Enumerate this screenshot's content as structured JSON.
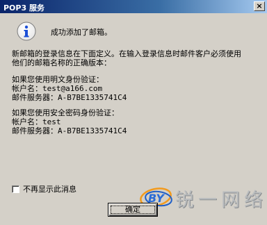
{
  "window": {
    "title": "POP3 服务",
    "close_label": "×"
  },
  "message": {
    "heading": "成功添加了邮箱。",
    "intro": [
      "新邮箱的登录信息在下面定义。在输入登录信息时邮件客户必须使用",
      "他们的邮箱名称的正确版本："
    ],
    "plaintext": {
      "heading": "如果您使用明文身份验证：",
      "account_label": "帐户名：",
      "account_value": "test@a166.com",
      "server_label": "邮件服务器：",
      "server_value": "A-B7BE1335741C4"
    },
    "spa": {
      "heading": "如果您使用安全密码身份验证：",
      "account_label": "帐户名：",
      "account_value": "test",
      "server_label": "邮件服务器：",
      "server_value": "A-B7BE1335741C4"
    }
  },
  "checkbox": {
    "label": "不再显示此消息",
    "checked": false
  },
  "ok_button": {
    "label": "确定"
  },
  "watermark": {
    "logo_text": "BY",
    "text": "锐一网络"
  },
  "icons": {
    "info": "info-icon",
    "close": "close-icon"
  },
  "colors": {
    "titlebar_start": "#0a246a",
    "titlebar_end": "#a6caf0",
    "face": "#d4d0c8",
    "info_blue": "#1c4fd6"
  }
}
